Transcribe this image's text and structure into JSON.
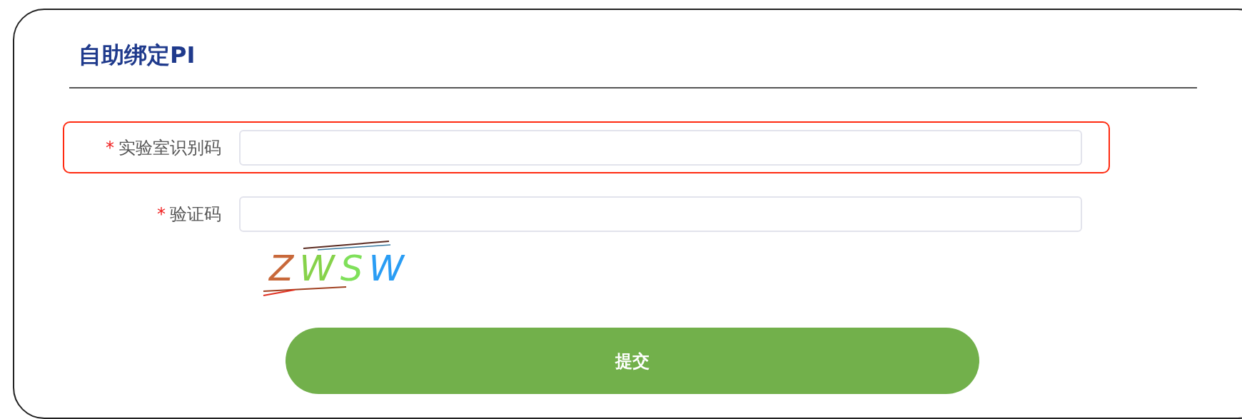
{
  "title": "自助绑定PI",
  "fields": [
    {
      "marker": "*",
      "label": "实验室识别码",
      "highlighted": true
    },
    {
      "marker": "*",
      "label": "验证码",
      "highlighted": false
    }
  ],
  "captcha": {
    "text": "ZWSW"
  },
  "submit": {
    "label": "提交"
  }
}
